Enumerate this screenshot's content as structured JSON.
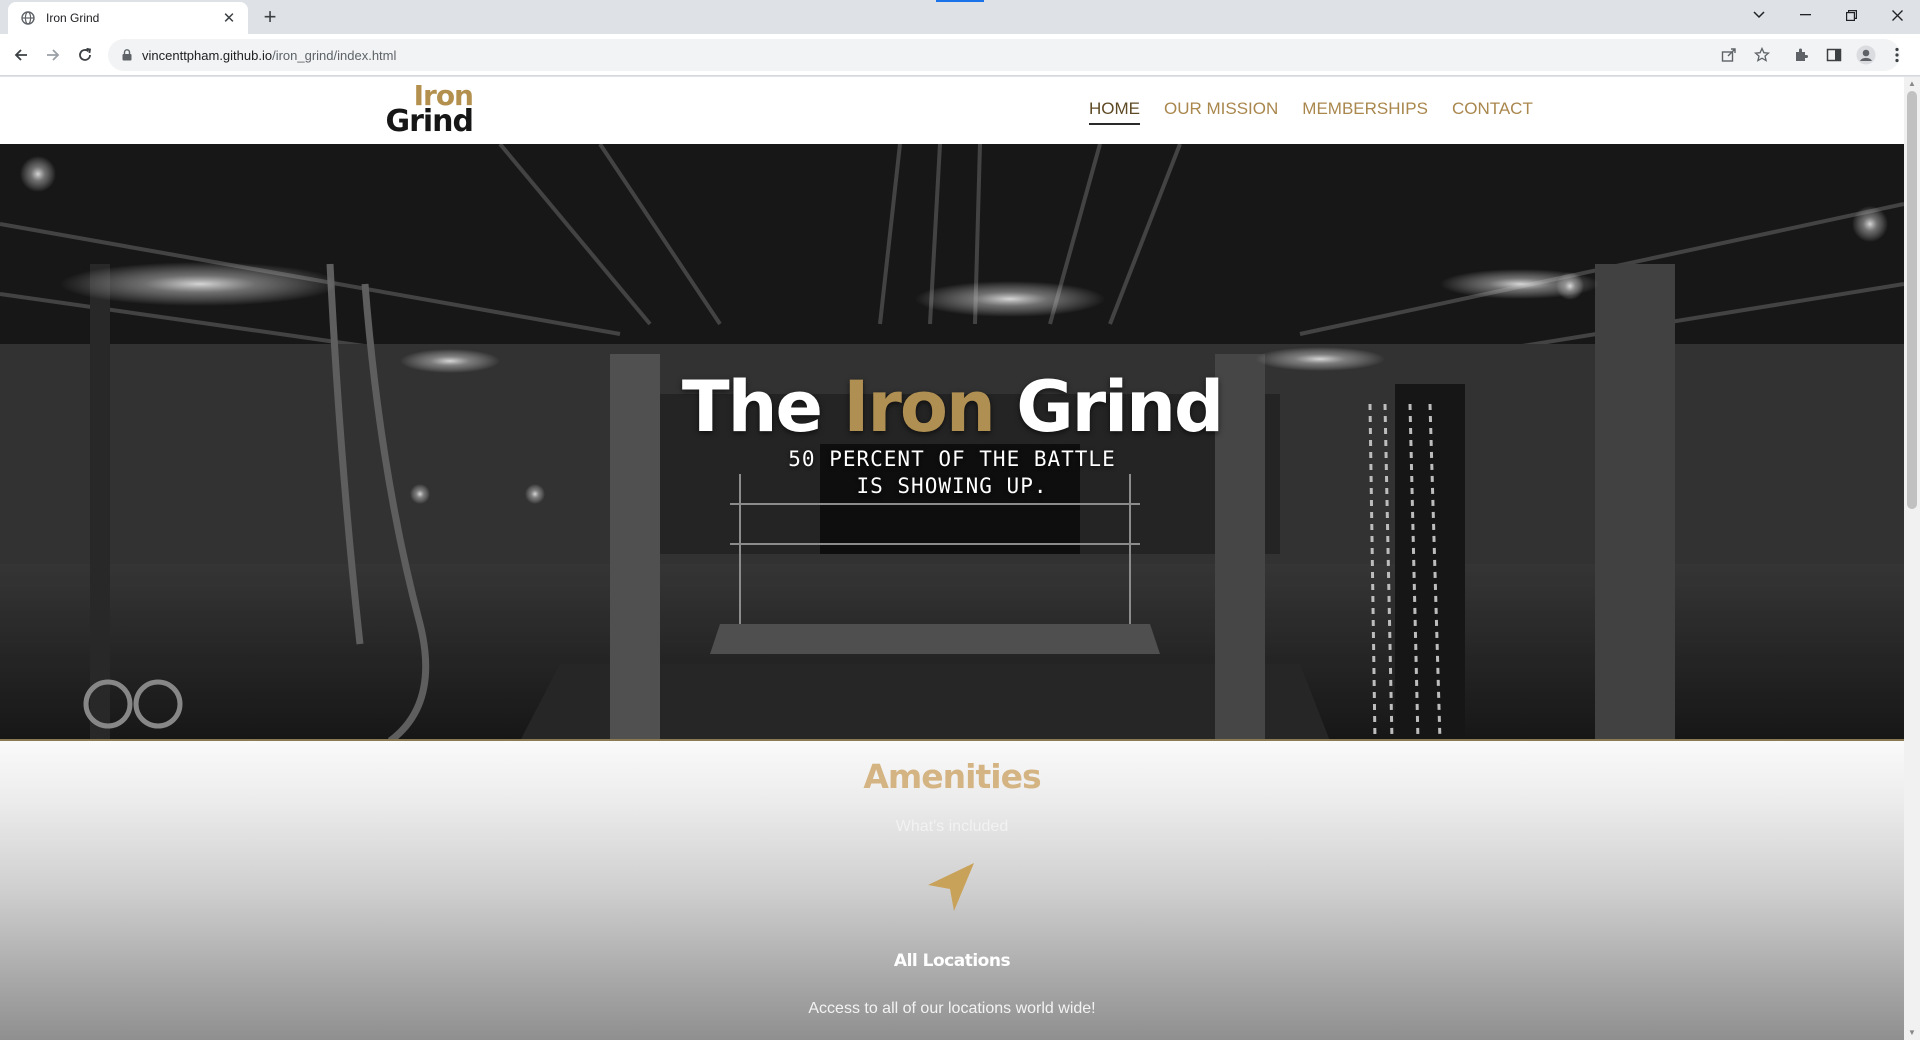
{
  "browser": {
    "tab": {
      "title": "Iron Grind",
      "favicon": "globe-icon"
    },
    "url": {
      "domain": "vincenttpham.github.io",
      "path": "/iron_grind/index.html"
    }
  },
  "site": {
    "logo": {
      "line1": "Iron",
      "line2": "Grind"
    },
    "nav": [
      {
        "label": "HOME",
        "active": true
      },
      {
        "label": "OUR MISSION",
        "active": false
      },
      {
        "label": "MEMBERSHIPS",
        "active": false
      },
      {
        "label": "CONTACT",
        "active": false
      }
    ],
    "hero": {
      "title_part1": "The",
      "title_part2": "Iron",
      "title_part3": "Grind",
      "subtitle_line1": "50 PERCENT OF THE BATTLE",
      "subtitle_line2": "IS SHOWING UP."
    },
    "amenities": {
      "title": "Amenities",
      "subtitle": "What's included",
      "item": {
        "icon": "location-arrow-icon",
        "title": "All Locations",
        "description": "Access to all of our locations world wide!"
      }
    }
  },
  "colors": {
    "gold": "#b08f52",
    "accent_blue": "#1a73e8"
  }
}
